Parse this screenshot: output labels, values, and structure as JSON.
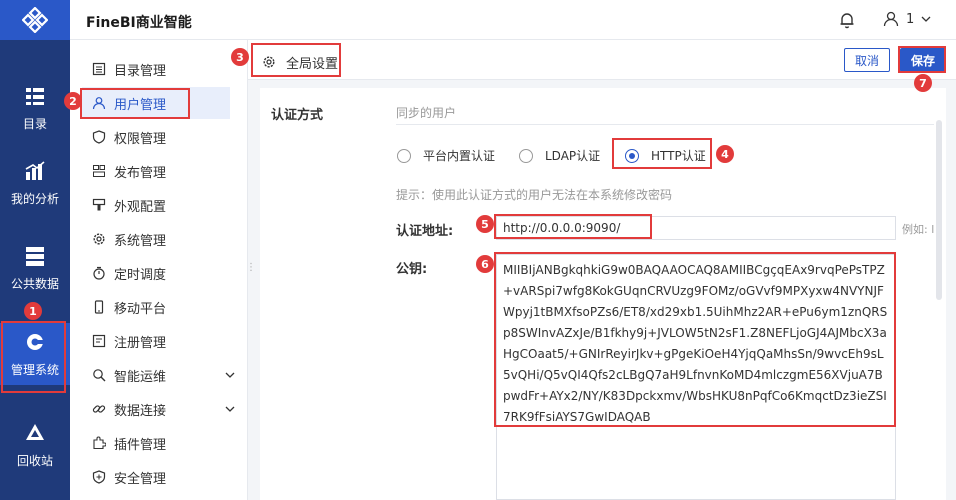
{
  "app": {
    "title": "FineBI商业智能"
  },
  "user": {
    "name": "1"
  },
  "rail": {
    "items": [
      {
        "label": "目录",
        "icon": "catalog-icon"
      },
      {
        "label": "我的分析",
        "icon": "chart-icon"
      },
      {
        "label": "公共数据",
        "icon": "database-icon"
      },
      {
        "label": "管理系统",
        "icon": "manage-gear-icon",
        "active": true
      },
      {
        "label": "回收站",
        "icon": "recycle-icon"
      }
    ]
  },
  "subnav": {
    "items": [
      {
        "label": "目录管理",
        "icon": "list-icon"
      },
      {
        "label": "用户管理",
        "icon": "user-icon",
        "active": true
      },
      {
        "label": "权限管理",
        "icon": "shield-icon"
      },
      {
        "label": "发布管理",
        "icon": "publish-icon"
      },
      {
        "label": "外观配置",
        "icon": "brush-icon"
      },
      {
        "label": "系统管理",
        "icon": "gear-icon"
      },
      {
        "label": "定时调度",
        "icon": "timer-icon"
      },
      {
        "label": "移动平台",
        "icon": "mobile-icon"
      },
      {
        "label": "注册管理",
        "icon": "register-icon"
      },
      {
        "label": "智能运维",
        "icon": "ops-icon",
        "expandable": true
      },
      {
        "label": "数据连接",
        "icon": "link-icon",
        "expandable": true
      },
      {
        "label": "插件管理",
        "icon": "plugin-icon"
      },
      {
        "label": "安全管理",
        "icon": "security-icon"
      }
    ]
  },
  "tab": {
    "label": "全局设置"
  },
  "buttons": {
    "cancel": "取消",
    "save": "保存"
  },
  "form": {
    "auth_label": "认证方式",
    "sync_users": "同步的用户",
    "options": [
      "平台内置认证",
      "LDAP认证",
      "HTTP认证"
    ],
    "selected": "HTTP认证",
    "hint": "提示：使用此认证方式的用户无法在本系统修改密码",
    "url_label": "认证地址:",
    "url_value": "http://0.0.0.0:9090/",
    "url_example": "例如: l",
    "key_label": "公钥:",
    "key_value": "MIIBIjANBgkqhkiG9w0BAQAAOCAQ8AMIIBCgçqEAx9rvqPePsTPZ+vARSpi7wfg8KokGUqnCRVUzg9FOMz/oGVvf9MPXyxw4NVYNJFWpyj1tBMXfsoPZs6/ET8/xd29xb1.5UihMhz2AR+ePu6ym1znQRSp8SWInvAZxJe/B1fkhy9j+JVLOW5tN2sF1.Z8NEFLjoGJ4AJMbcX3aHgCOaat5/+GNIrReyirJkv+gPgeKiOeH4YjqQaMhsSn/9wvcEh9sL5vQHi/Q5vQI4Qfs2cLBgQ7aH9LfnvnKoMD4mlczgmE56XVjuA7BpwdFr+AYx2/NY/K83Dpckxmv/WbsHKU8nPqfCo6KmqctDz3ieZSI7RK9fFsiAYS7GwIDAQAB"
  },
  "annotations": [
    "1",
    "2",
    "3",
    "4",
    "5",
    "6",
    "7"
  ],
  "colors": {
    "rail_bg": "#1f3a7a",
    "accent": "#2a58c8",
    "annotation": "#e23b3b"
  }
}
